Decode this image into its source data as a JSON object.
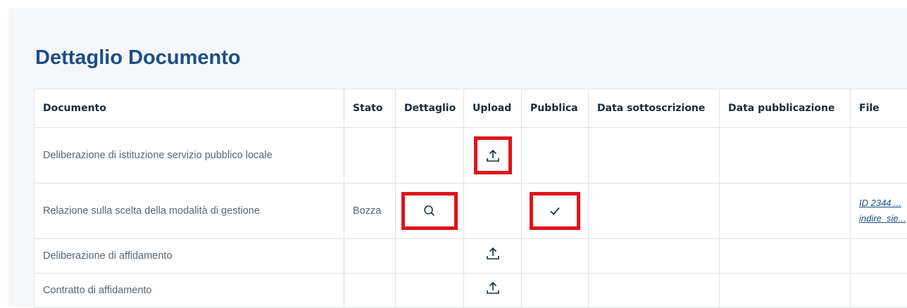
{
  "page": {
    "title": "Dettaglio Documento"
  },
  "table": {
    "headers": [
      "Documento",
      "Stato",
      "Dettaglio",
      "Upload",
      "Pubblica",
      "Data sottoscrizione",
      "Data pubblicazione",
      "File"
    ],
    "rows": [
      {
        "documento": "Deliberazione di istituzione servizio pubblico locale",
        "stato": "",
        "dettaglio_icon": "",
        "upload_icon": "upload-icon",
        "pubblica_icon": "",
        "data_sottoscrizione": "",
        "data_pubblicazione": "",
        "file": ""
      },
      {
        "documento": "Relazione sulla scelta della modalità di gestione",
        "stato": "Bozza",
        "dettaglio_icon": "search-icon",
        "upload_icon": "",
        "pubblica_icon": "check-icon",
        "data_sottoscrizione": "",
        "data_pubblicazione": "",
        "file_line1": "ID 2344 ...",
        "file_line2": "indire_sie..."
      },
      {
        "documento": "Deliberazione di affidamento",
        "stato": "",
        "upload_icon": "upload-icon",
        "data_sottoscrizione": "",
        "data_pubblicazione": "",
        "file": ""
      },
      {
        "documento": "Contratto di affidamento",
        "stato": "",
        "upload_icon": "upload-icon",
        "data_sottoscrizione": "",
        "data_pubblicazione": "",
        "file": ""
      }
    ]
  },
  "colors": {
    "title": "#1b4f84",
    "highlight_border": "#e0131b",
    "panel_bg": "#f5f7fa",
    "table_border": "#dfe3e8"
  }
}
